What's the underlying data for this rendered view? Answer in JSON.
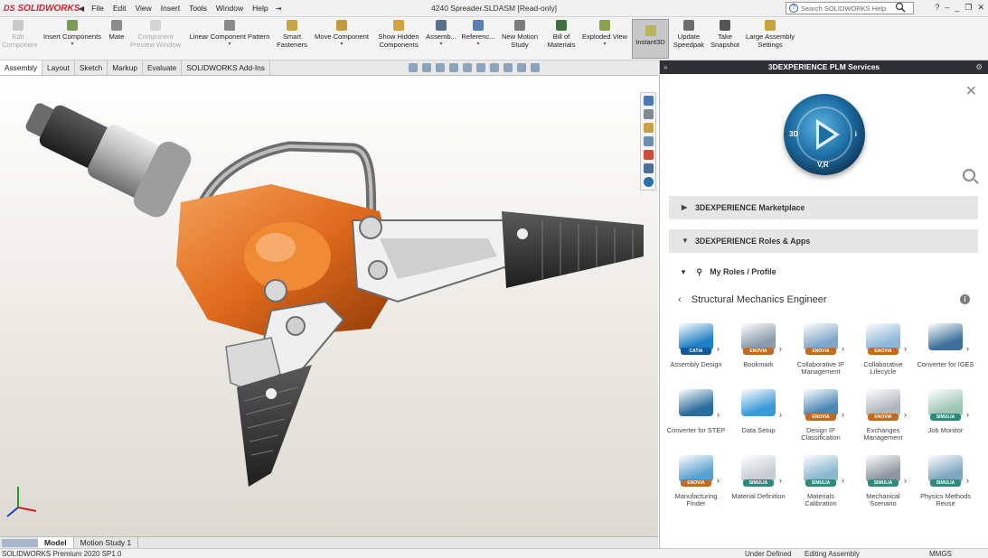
{
  "titlebar": {
    "logo_prefix": "DS",
    "logo_text": "SOLIDWORKS",
    "menu": [
      "File",
      "Edit",
      "View",
      "Insert",
      "Tools",
      "Window",
      "Help"
    ],
    "doc_title": "4240 Spreader.SLDASM [Read-only]",
    "search_placeholder": "Search SOLIDWORKS Help",
    "window_controls": [
      "?",
      "–",
      "_",
      "❐",
      "✕"
    ]
  },
  "ribbon": {
    "edit_component": "Edit Component",
    "insert_components": "Insert Components",
    "mate": "Mate",
    "component_preview": "Component Preview Window",
    "linear_pattern": "Linear Component Pattern",
    "smart_fasteners": "Smart Fasteners",
    "move_component": "Move Component",
    "show_hidden": "Show Hidden Components",
    "assembly": "Assemb...",
    "reference": "Referenc...",
    "new_motion": "New Motion Study",
    "bom": "Bill of Materials",
    "exploded": "Exploded View",
    "instant3d": "Instant3D",
    "update_speedpak": "Update Speedpak",
    "take_snapshot": "Take Snapshot",
    "large_assembly": "Large Assembly Settings"
  },
  "command_tabs": [
    "Assembly",
    "Layout",
    "Sketch",
    "Markup",
    "Evaluate",
    "SOLIDWORKS Add-Ins"
  ],
  "bottom_tabs": [
    "Model",
    "Motion Study 1"
  ],
  "status": {
    "left": "SOLIDWORKS Premium 2020 SP1.0",
    "state": "Under Defined",
    "mode": "Editing Assembly",
    "units": "MMGS"
  },
  "panel": {
    "title": "3DEXPERIENCE PLM Services",
    "compass": {
      "left": "3D",
      "right": "i",
      "bottom": "V,R"
    },
    "marketplace": "3DEXPERIENCE Marketplace",
    "roles_apps": "3DEXPERIENCE Roles & Apps",
    "my_roles": "My Roles / Profile",
    "role_name": "Structural Mechanics Engineer",
    "apps": [
      {
        "label": "Assembly Design",
        "badge": "CATIA",
        "color": "#1f7fc4",
        "badge_color": "#0d5c99"
      },
      {
        "label": "Bookmark",
        "badge": "ENOVIA",
        "color": "#8a9bab",
        "badge_color": "#c66a1a"
      },
      {
        "label": "Collaborative IP Management",
        "badge": "ENOVIA",
        "color": "#7fa7c9",
        "badge_color": "#c66a1a"
      },
      {
        "label": "Collaborative Lifecycle",
        "badge": "ENOVIA",
        "color": "#8fb8d8",
        "badge_color": "#c66a1a"
      },
      {
        "label": "Converter for IGES",
        "badge": "",
        "color": "#3d6f9a",
        "badge_color": "#3d6f9a"
      },
      {
        "label": "Converter for STEP",
        "badge": "",
        "color": "#2a6c9c",
        "badge_color": "#2a6c9c"
      },
      {
        "label": "Data Setup",
        "badge": "",
        "color": "#3a9ad6",
        "badge_color": "#3a9ad6"
      },
      {
        "label": "Design IP Classification",
        "badge": "ENOVIA",
        "color": "#4b86b4",
        "badge_color": "#c66a1a"
      },
      {
        "label": "Exchanges Management",
        "badge": "ENOVIA",
        "color": "#b0b7be",
        "badge_color": "#c66a1a"
      },
      {
        "label": "Job Monitor",
        "badge": "SIMULIA",
        "color": "#9fc6b4",
        "badge_color": "#2e8a7a"
      },
      {
        "label": "Manufacturing Finder",
        "badge": "ENOVIA",
        "color": "#5aa0cf",
        "badge_color": "#c66a1a"
      },
      {
        "label": "Material Definition",
        "badge": "SIMULIA",
        "color": "#c7cdd3",
        "badge_color": "#2e8a7a"
      },
      {
        "label": "Materials Calibration",
        "badge": "SIMULIA",
        "color": "#89b7cc",
        "badge_color": "#2e8a7a"
      },
      {
        "label": "Mechanical Scenario",
        "badge": "SIMULIA",
        "color": "#8e979f",
        "badge_color": "#2e8a7a"
      },
      {
        "label": "Physics Methods Reuse",
        "badge": "SIMULIA",
        "color": "#7ea6bf",
        "badge_color": "#2e8a7a"
      }
    ]
  },
  "colors": {
    "brand_red": "#d0202e",
    "orange_part": "#e06a1c",
    "panel_header": "#2f3036"
  }
}
